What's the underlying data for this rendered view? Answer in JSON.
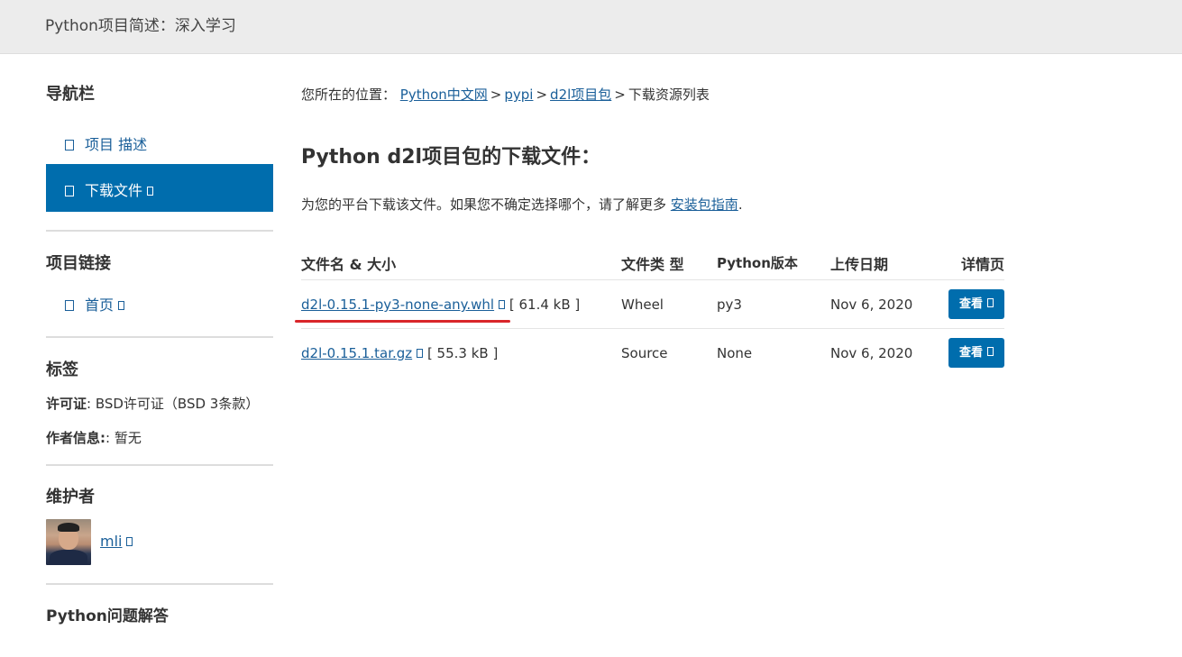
{
  "header": {
    "title": "Python项目简述：深入学习"
  },
  "sidebar": {
    "nav_heading": "导航栏",
    "nav_items": [
      {
        "label": "项目 描述",
        "active": false
      },
      {
        "label": "下载文件",
        "active": true
      }
    ],
    "links_heading": "项目链接",
    "links": [
      {
        "label": "首页"
      }
    ],
    "tags_heading": "标签",
    "license_label": "许可证",
    "license_value": ": BSD许可证（BSD 3条款）",
    "author_label": "作者信息:",
    "author_value": ": 暂无",
    "maintainers_heading": "维护者",
    "maintainer_name": "mli",
    "qa_heading": "Python问题解答"
  },
  "breadcrumb": {
    "prefix": "您所在的位置：",
    "items": [
      "Python中文网",
      "pypi",
      "d2l项目包"
    ],
    "current": "下载资源列表",
    "separator": ">"
  },
  "main": {
    "title": "Python d2l项目包的下载文件：",
    "intro_text": "为您的平台下载该文件。如果您不确定选择哪个，请了解更多",
    "intro_link": "安装包指南",
    "intro_end": "."
  },
  "table": {
    "headers": [
      "文件名 & 大小",
      "文件类 型",
      "Python版本",
      "上传日期",
      "详情页"
    ],
    "rows": [
      {
        "filename": "d2l-0.15.1-py3-none-any.whl",
        "size": "[ 61.4 kB ]",
        "type": "Wheel",
        "python": "py3",
        "date": "Nov 6, 2020",
        "button": "查看"
      },
      {
        "filename": "d2l-0.15.1.tar.gz",
        "size": "[ 55.3 kB ]",
        "type": "Source",
        "python": "None",
        "date": "Nov 6, 2020",
        "button": "查看"
      }
    ]
  },
  "colors": {
    "accent": "#006dad",
    "link": "#1a5f99",
    "highlight_underline": "#d9262a",
    "topbar": "#ececec"
  }
}
